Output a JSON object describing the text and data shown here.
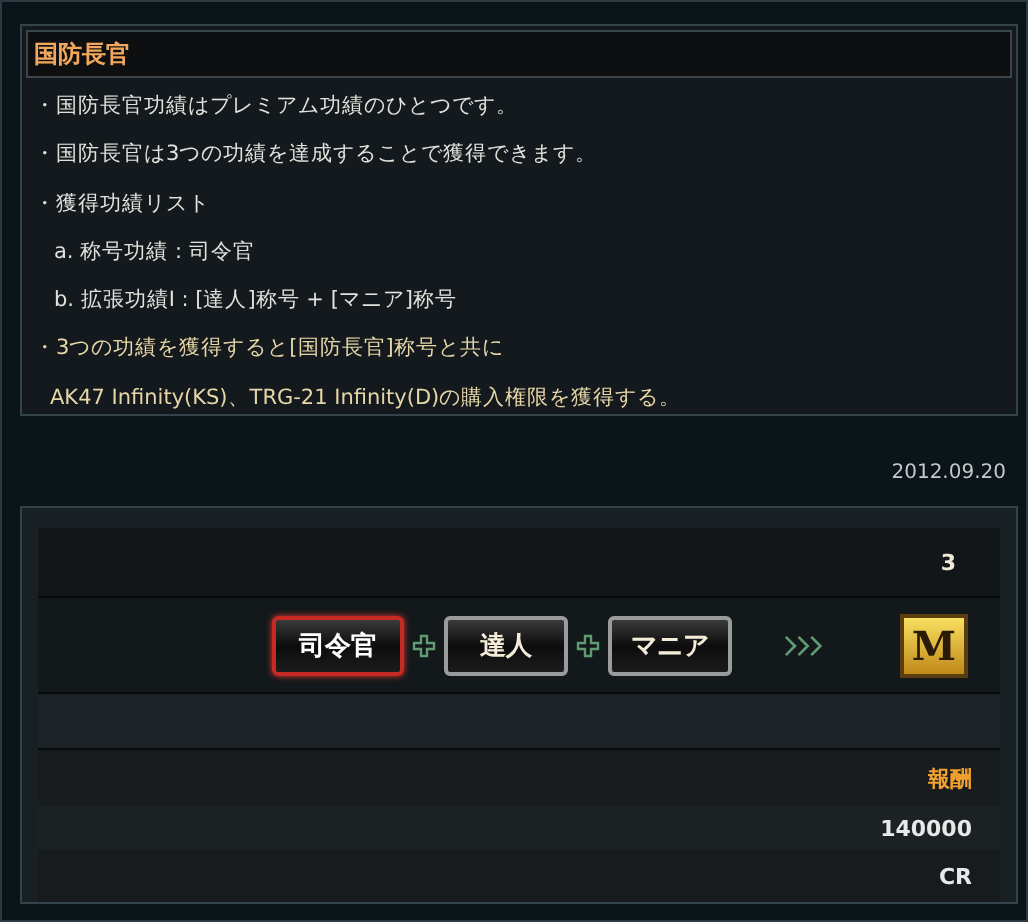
{
  "title": "国防長官",
  "lines": [
    {
      "text": "・国防長官功績はプレミアム功績のひとつです。",
      "kind": "bullet"
    },
    {
      "text": "・国防長官は3つの功績を達成することで獲得できます。",
      "kind": "bullet"
    },
    {
      "text": "・獲得功績リスト",
      "kind": "bullet"
    },
    {
      "text": "a. 称号功績 : 司令官",
      "kind": "sub"
    },
    {
      "text": "b. 拡張功績I : [達人]称号 + [マニア]称号",
      "kind": "sub"
    },
    {
      "text": "・3つの功績を獲得すると[国防長官]称号と共に",
      "kind": "note"
    },
    {
      "text": "AK47 Infinity(KS)、TRG-21 Infinity(D)の購入権限を獲得する。",
      "kind": "note_cont"
    }
  ],
  "date": "2012.09.20",
  "count": "3",
  "badges": [
    {
      "label": "司令官",
      "selected": true
    },
    {
      "label": "達人",
      "selected": false
    },
    {
      "label": "マニア",
      "selected": false
    }
  ],
  "result_badge": "M",
  "reward_label": "報酬",
  "reward_amount": "140000",
  "reward_unit": "CR"
}
